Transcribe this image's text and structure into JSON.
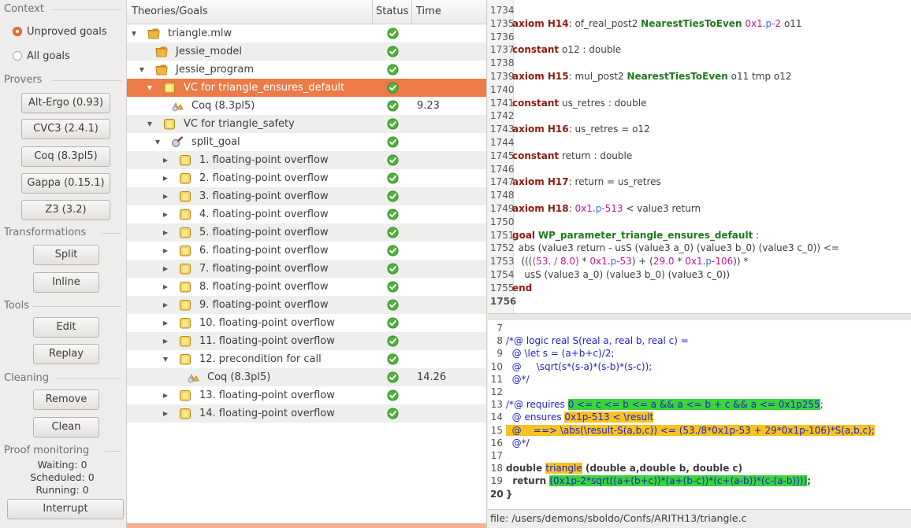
{
  "context": {
    "header": "Context",
    "options": [
      {
        "label": "Unproved goals",
        "selected": true
      },
      {
        "label": "All goals",
        "selected": false
      }
    ]
  },
  "provers": {
    "header": "Provers",
    "buttons": [
      "Alt-Ergo (0.93)",
      "CVC3 (2.4.1)",
      "Coq (8.3pl5)",
      "Gappa (0.15.1)",
      "Z3 (3.2)"
    ]
  },
  "transformations": {
    "header": "Transformations",
    "buttons": [
      "Split",
      "Inline"
    ]
  },
  "tools": {
    "header": "Tools",
    "buttons": [
      "Edit",
      "Replay"
    ]
  },
  "cleaning": {
    "header": "Cleaning",
    "buttons": [
      "Remove",
      "Clean"
    ]
  },
  "monitoring": {
    "header": "Proof monitoring",
    "waiting": "Waiting: 0",
    "scheduled": "Scheduled: 0",
    "running": "Running: 0",
    "interrupt": "Interrupt"
  },
  "tree": {
    "columns": [
      "Theories/Goals",
      "Status",
      "Time"
    ],
    "rows": [
      {
        "label": "triangle.mlw",
        "time": "",
        "icon": "folder-icon"
      },
      {
        "label": "Jessie_model",
        "time": "",
        "icon": "folder-icon"
      },
      {
        "label": "Jessie_program",
        "time": "",
        "icon": "folder-icon"
      },
      {
        "label": "VC for triangle_ensures_default",
        "time": "",
        "icon": "goal-icon"
      },
      {
        "label": "Coq (8.3pl5)",
        "time": "9.23",
        "icon": "prover-icon"
      },
      {
        "label": "VC for triangle_safety",
        "time": "",
        "icon": "goal-icon"
      },
      {
        "label": "split_goal",
        "time": "",
        "icon": "transform-icon"
      },
      {
        "label": "1. floating-point overflow",
        "time": "",
        "icon": "goal-icon"
      },
      {
        "label": "2. floating-point overflow",
        "time": "",
        "icon": "goal-icon"
      },
      {
        "label": "3. floating-point overflow",
        "time": "",
        "icon": "goal-icon"
      },
      {
        "label": "4. floating-point overflow",
        "time": "",
        "icon": "goal-icon"
      },
      {
        "label": "5. floating-point overflow",
        "time": "",
        "icon": "goal-icon"
      },
      {
        "label": "6. floating-point overflow",
        "time": "",
        "icon": "goal-icon"
      },
      {
        "label": "7. floating-point overflow",
        "time": "",
        "icon": "goal-icon"
      },
      {
        "label": "8. floating-point overflow",
        "time": "",
        "icon": "goal-icon"
      },
      {
        "label": "9. floating-point overflow",
        "time": "",
        "icon": "goal-icon"
      },
      {
        "label": "10. floating-point overflow",
        "time": "",
        "icon": "goal-icon"
      },
      {
        "label": "11. floating-point overflow",
        "time": "",
        "icon": "goal-icon"
      },
      {
        "label": "12. precondition for call",
        "time": "",
        "icon": "goal-icon"
      },
      {
        "label": "Coq (8.3pl5)",
        "time": "14.26",
        "icon": "prover-icon"
      },
      {
        "label": "13. floating-point overflow",
        "time": "",
        "icon": "goal-icon"
      },
      {
        "label": "14. floating-point overflow",
        "time": "",
        "icon": "goal-icon"
      }
    ]
  },
  "task_view": {
    "lines": [
      {
        "n": "1734",
        "parts": []
      },
      {
        "n": "1735",
        "parts": [
          [
            "kw",
            "axiom H14"
          ],
          [
            "t",
            ": of_real_post2 "
          ],
          [
            "nm",
            "NearestTiesToEven"
          ],
          [
            "t",
            " "
          ],
          [
            "hx",
            "0x1"
          ],
          [
            "t",
            "."
          ],
          [
            "nb",
            "p"
          ],
          [
            "hx",
            "-2"
          ],
          [
            "t",
            " o11"
          ]
        ]
      },
      {
        "n": "1736",
        "parts": []
      },
      {
        "n": "1737",
        "parts": [
          [
            "kw",
            "constant"
          ],
          [
            "t",
            " o12 : double"
          ]
        ]
      },
      {
        "n": "1738",
        "parts": []
      },
      {
        "n": "1739",
        "parts": [
          [
            "kw",
            "axiom H15"
          ],
          [
            "t",
            ": mul_post2 "
          ],
          [
            "nm",
            "NearestTiesToEven"
          ],
          [
            "t",
            " o11 tmp o12"
          ]
        ]
      },
      {
        "n": "1740",
        "parts": []
      },
      {
        "n": "1741",
        "parts": [
          [
            "kw",
            "constant"
          ],
          [
            "t",
            " us_retres : double"
          ]
        ]
      },
      {
        "n": "1742",
        "parts": []
      },
      {
        "n": "1743",
        "parts": [
          [
            "kw",
            "axiom H16"
          ],
          [
            "t",
            ": us_retres = o12"
          ]
        ]
      },
      {
        "n": "1744",
        "parts": []
      },
      {
        "n": "1745",
        "parts": [
          [
            "kw",
            "constant"
          ],
          [
            "t",
            " return : double"
          ]
        ]
      },
      {
        "n": "1746",
        "parts": []
      },
      {
        "n": "1747",
        "parts": [
          [
            "kw",
            "axiom H17"
          ],
          [
            "t",
            ": return = us_retres"
          ]
        ]
      },
      {
        "n": "1748",
        "parts": []
      },
      {
        "n": "1749",
        "parts": [
          [
            "kw",
            "axiom H18"
          ],
          [
            "t",
            ": "
          ],
          [
            "hx",
            "0x1"
          ],
          [
            "t",
            "."
          ],
          [
            "nb",
            "p"
          ],
          [
            "hx",
            "-513"
          ],
          [
            "t",
            " < value3 return"
          ]
        ]
      },
      {
        "n": "1750",
        "parts": []
      },
      {
        "n": "1751",
        "parts": [
          [
            "kw",
            "goal"
          ],
          [
            "t",
            " "
          ],
          [
            "nm",
            "WP_parameter_triangle_ensures_default"
          ],
          [
            "t",
            " :"
          ]
        ]
      },
      {
        "n": "1752",
        "parts": [
          [
            "t",
            "  abs (value3 return - usS (value3 a_0) (value3 b_0) (value3 c_0)) <="
          ]
        ]
      },
      {
        "n": "1753",
        "parts": [
          [
            "t",
            "   ((("
          ],
          [
            "hx",
            "(53. / 8.0)"
          ],
          [
            "t",
            " * "
          ],
          [
            "hx",
            "0x1"
          ],
          [
            "t",
            "."
          ],
          [
            "nb",
            "p"
          ],
          [
            "hx",
            "-53"
          ],
          [
            "t",
            ") + ("
          ],
          [
            "hx",
            "29.0"
          ],
          [
            "t",
            " * "
          ],
          [
            "hx",
            "0x1"
          ],
          [
            "t",
            "."
          ],
          [
            "nb",
            "p"
          ],
          [
            "hx",
            "-106"
          ],
          [
            "t",
            ")) *"
          ]
        ]
      },
      {
        "n": "1754",
        "parts": [
          [
            "t",
            "    usS (value3 a_0) (value3 b_0) (value3 c_0))"
          ]
        ]
      },
      {
        "n": "1755",
        "parts": [
          [
            "kw",
            "end"
          ]
        ]
      },
      {
        "n": "1756",
        "parts": []
      }
    ]
  },
  "source_view": {
    "lines": [
      {
        "n": "7",
        "parts": []
      },
      {
        "n": "8",
        "parts": [
          [
            "t",
            "/*@ logic real S(real a, real b, real c) ="
          ]
        ]
      },
      {
        "n": "9",
        "parts": [
          [
            "t",
            "  @ \\let s = (a+b+c)/2;"
          ]
        ]
      },
      {
        "n": "10",
        "parts": [
          [
            "t",
            "  @     \\sqrt(s*(s-a)*(s-b)*(s-c));"
          ]
        ]
      },
      {
        "n": "11",
        "parts": [
          [
            "t",
            "  @*/"
          ]
        ]
      },
      {
        "n": "12",
        "parts": []
      },
      {
        "n": "13",
        "parts": [
          [
            "t",
            "/*@ requires "
          ],
          [
            "g",
            "0 <= c <= b <= a && a <= b + c && a <= 0x1p255"
          ],
          [
            "t",
            ";"
          ]
        ]
      },
      {
        "n": "14",
        "parts": [
          [
            "t",
            "  @ ensures "
          ],
          [
            "y",
            "0x1p-513 < \\result"
          ]
        ]
      },
      {
        "n": "15",
        "parts": [
          [
            "y",
            "  @    ==> \\abs(\\result-S(a,b,c)) <= (53./8*0x1p-53 + 29*0x1p-106)*S(a,b,c);"
          ]
        ]
      },
      {
        "n": "16",
        "parts": [
          [
            "t",
            "  @*/"
          ]
        ]
      },
      {
        "n": "17",
        "parts": []
      },
      {
        "n": "18",
        "parts": [
          [
            "b",
            "double "
          ],
          [
            "y",
            "triangle"
          ],
          [
            "b",
            " (double a,double b, double c) "
          ]
        ]
      },
      {
        "n": "19",
        "parts": [
          [
            "b",
            "  return "
          ],
          [
            "g",
            "(0x1p-2*sqrt((a+(b+c))*(a+(b-c))*(c+(a-b))*(c-(a-b))))"
          ],
          [
            "b",
            ";"
          ]
        ]
      },
      {
        "n": "20",
        "parts": [
          [
            "b",
            "}"
          ]
        ]
      }
    ]
  },
  "statusbar": {
    "text": "file: /users/demons/sboldo/Confs/ARITH13/triangle.c"
  },
  "colors": {
    "accent": "#ec7b47",
    "proved": "#4fb33a"
  }
}
